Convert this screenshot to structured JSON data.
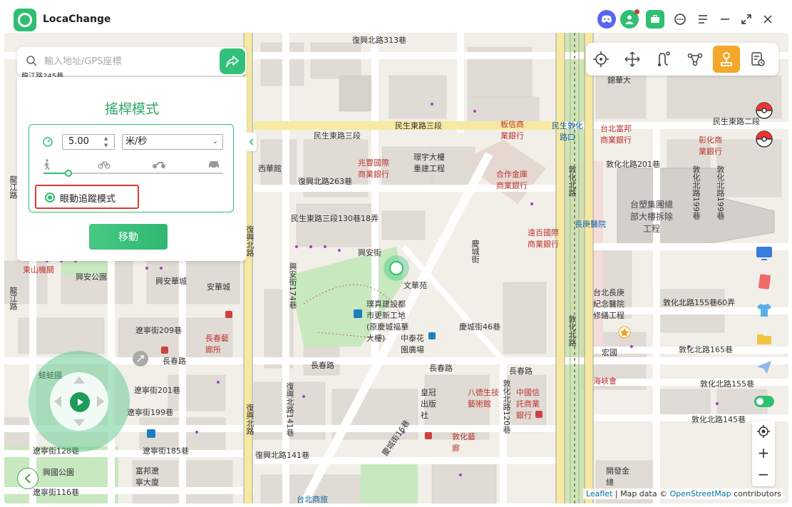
{
  "app": {
    "title": "LocaChange"
  },
  "titlebar_icons": [
    "discord-icon",
    "avatar-icon",
    "toolbox-icon",
    "chat-icon",
    "menu-icon",
    "minimize-icon",
    "restore-icon",
    "close-icon"
  ],
  "search": {
    "placeholder": "輸入地址/GPS座標",
    "partial_text": "龍江路245巷"
  },
  "mode_panel": {
    "title": "搖桿模式",
    "speed_value": "5.00",
    "unit_selected": "米/秒",
    "speed_fraction": 0.14,
    "eye_tracking_label": "眼動追蹤模式",
    "eye_tracking_checked": true,
    "move_button": "移動",
    "transport_modes": [
      "walk-icon",
      "bike-icon",
      "motorcycle-icon",
      "car-icon"
    ]
  },
  "toolbar": {
    "tools": [
      "teleport-icon",
      "multi-spot-icon",
      "two-spot-icon",
      "jump-icon",
      "joystick-icon",
      "history-icon"
    ],
    "active": "joystick-icon"
  },
  "side_tools": [
    "pokeball-icon",
    "pokeball2-icon",
    "screen-icon",
    "red-card-icon",
    "shirt-icon",
    "folder-icon",
    "send-icon",
    "toggle-icon"
  ],
  "zoom": {
    "locate": "⊙",
    "plus": "+",
    "minus": "−"
  },
  "attribution": {
    "leaflet": "Leaflet",
    "sep1": " | Map data © ",
    "osm": "OpenStreetMap",
    "tail": " contributors"
  },
  "map_labels": [
    {
      "t": "復興北路313巷"
    },
    {
      "t": "民生東路三段"
    },
    {
      "t": "民生東路三段"
    },
    {
      "t": "民生東路二段"
    },
    {
      "t": "敦化北路201巷"
    },
    {
      "t": "敦化北路199巷"
    },
    {
      "t": "復興北路263巷"
    },
    {
      "t": "民生東路三段130巷18弄"
    },
    {
      "t": "興安街"
    },
    {
      "t": "興安華城"
    },
    {
      "t": "遼寧街209巷"
    },
    {
      "t": "長春路"
    },
    {
      "t": "長春路"
    },
    {
      "t": "長春路"
    },
    {
      "t": "長春路"
    },
    {
      "t": "慶城街46巷"
    },
    {
      "t": "敦化北路165巷"
    },
    {
      "t": "敦化北路155巷"
    },
    {
      "t": "敦化北路145巷"
    },
    {
      "t": "敦化北路155巷60弄"
    },
    {
      "t": "遼寧街201巷"
    },
    {
      "t": "遼寧街199巷"
    },
    {
      "t": "遼寧街185巷"
    },
    {
      "t": "遼寧街128巷"
    },
    {
      "t": "遼寧街116巷"
    },
    {
      "t": "復興北路141巷"
    },
    {
      "t": "台塑集團總部大樓拆除工程"
    },
    {
      "t": "台北長庚紀念醫院修繕工程"
    },
    {
      "t": "璞真建設都市更新工地(原慶城福華大樓)"
    },
    {
      "t": "興國公園"
    },
    {
      "t": "興安公園"
    },
    {
      "t": "宏國"
    },
    {
      "t": "中泰花園廣場"
    },
    {
      "t": "文華苑"
    },
    {
      "t": "長庚醫院"
    },
    {
      "t": "民生敦化路口"
    },
    {
      "t": "台北富邦商業銀行"
    },
    {
      "t": "合作金庫商業銀行"
    },
    {
      "t": "兆豐國際商業銀行"
    },
    {
      "t": "遠百國際商業銀行"
    },
    {
      "t": "彰化商業銀行"
    },
    {
      "t": "板信商業銀行"
    },
    {
      "t": "錦華大"
    },
    {
      "t": "西華館"
    },
    {
      "t": "璟宇大樓重建工程"
    },
    {
      "t": "慶城街"
    },
    {
      "t": "興安街174巷"
    },
    {
      "t": "敦化北路"
    },
    {
      "t": "敦化北路"
    },
    {
      "t": "復興北路"
    },
    {
      "t": "復興北路"
    },
    {
      "t": "龍江路"
    },
    {
      "t": "龍江路"
    },
    {
      "t": "蛙蛙國"
    },
    {
      "t": "富邦遼寧大廈"
    },
    {
      "t": "開發金總"
    },
    {
      "t": "海峽會"
    },
    {
      "t": "皇冠出版社"
    },
    {
      "t": "中國信託商業銀行"
    },
    {
      "t": "敦化藝廊"
    },
    {
      "t": "長春藝廊所"
    },
    {
      "t": "台北商旅"
    },
    {
      "t": "慶城街16巷"
    },
    {
      "t": "復興北路141巷"
    },
    {
      "t": "東山機關"
    },
    {
      "t": "安華城"
    },
    {
      "t": "敦化北路120巷"
    },
    {
      "t": "敦化北路199巷"
    },
    {
      "t": "八德生技藝術館"
    }
  ]
}
